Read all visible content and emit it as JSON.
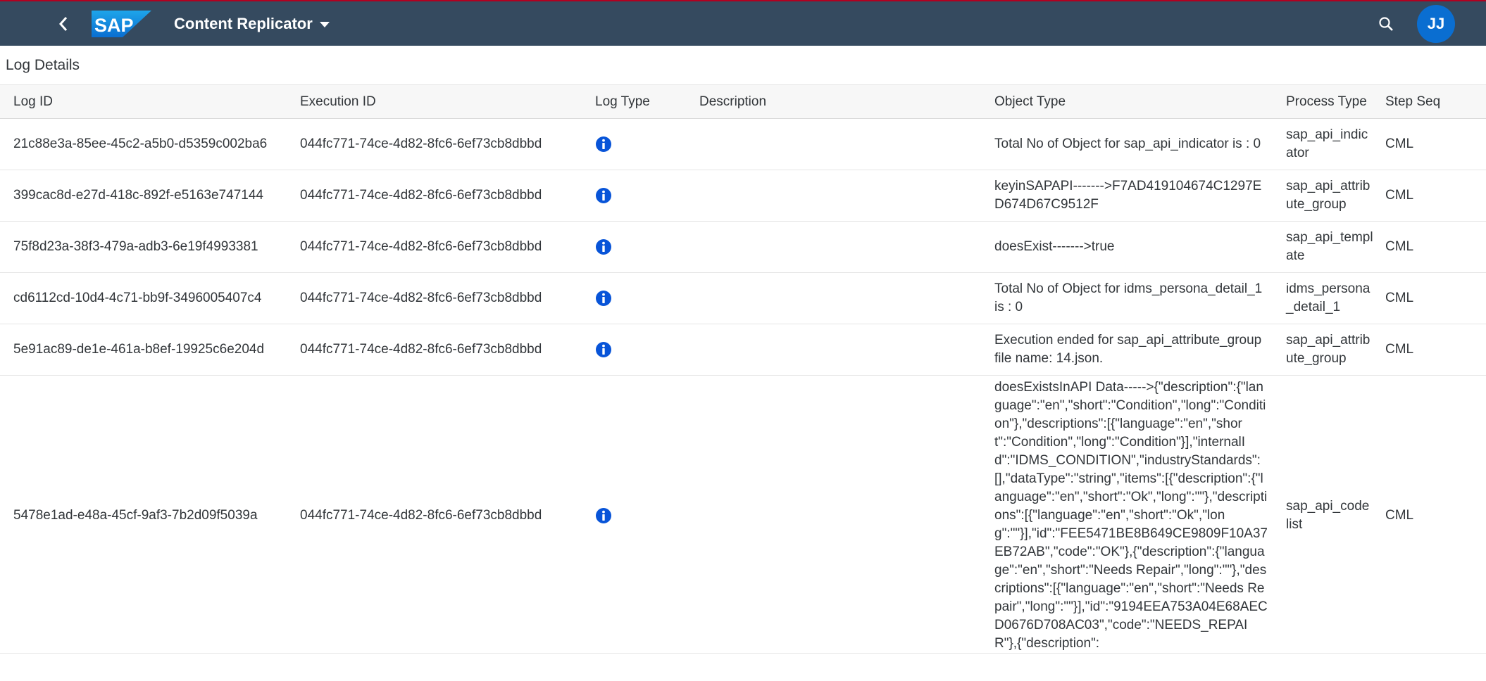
{
  "shell": {
    "app_title": "Content Replicator",
    "logo_text": "SAP",
    "user_initials": "JJ",
    "icons": {
      "back": "chevron-left-icon",
      "search": "search-icon",
      "menu": "caret-down-icon"
    },
    "colors": {
      "shell_bg": "#354a5f",
      "accent": "#0a6ed1",
      "info_icon": "#0854d8"
    }
  },
  "page": {
    "title": "Log Details"
  },
  "table": {
    "headers": {
      "log_id": "Log ID",
      "execution_id": "Execution ID",
      "log_type": "Log Type",
      "description": "Description",
      "object_type": "Object Type",
      "process_type": "Process Type",
      "step_seq": "Step Seq"
    },
    "rows": [
      {
        "log_id": "21c88e3a-85ee-45c2-a5b0-d5359c002ba6",
        "execution_id": "044fc771-74ce-4d82-8fc6-6ef73cb8dbbd",
        "log_type": "info-icon",
        "description": "",
        "object_type": "Total No of Object for sap_api_indicator is : 0",
        "process_type": "sap_api_indicator",
        "step_seq": "CML"
      },
      {
        "log_id": "399cac8d-e27d-418c-892f-e5163e747144",
        "execution_id": "044fc771-74ce-4d82-8fc6-6ef73cb8dbbd",
        "log_type": "info-icon",
        "description": "",
        "object_type": "keyinSAPAPI------->F7AD419104674C1297ED674D67C9512F",
        "process_type": "sap_api_attribute_group",
        "step_seq": "CML"
      },
      {
        "log_id": "75f8d23a-38f3-479a-adb3-6e19f4993381",
        "execution_id": "044fc771-74ce-4d82-8fc6-6ef73cb8dbbd",
        "log_type": "info-icon",
        "description": "",
        "object_type": "doesExist------->true",
        "process_type": "sap_api_template",
        "step_seq": "CML"
      },
      {
        "log_id": "cd6112cd-10d4-4c71-bb9f-3496005407c4",
        "execution_id": "044fc771-74ce-4d82-8fc6-6ef73cb8dbbd",
        "log_type": "info-icon",
        "description": "",
        "object_type": "Total No of Object for idms_persona_detail_1 is : 0",
        "process_type": "idms_persona_detail_1",
        "step_seq": "CML"
      },
      {
        "log_id": "5e91ac89-de1e-461a-b8ef-19925c6e204d",
        "execution_id": "044fc771-74ce-4d82-8fc6-6ef73cb8dbbd",
        "log_type": "info-icon",
        "description": "",
        "object_type": "Execution ended for sap_api_attribute_group file name: 14.json.",
        "process_type": "sap_api_attribute_group",
        "step_seq": "CML"
      },
      {
        "log_id": "5478e1ad-e48a-45cf-9af3-7b2d09f5039a",
        "execution_id": "044fc771-74ce-4d82-8fc6-6ef73cb8dbbd",
        "log_type": "info-icon",
        "description": "",
        "object_type": "doesExistsInAPI Data----->{\"description\":{\"language\":\"en\",\"short\":\"Condition\",\"long\":\"Condition\"},\"descriptions\":[{\"language\":\"en\",\"short\":\"Condition\",\"long\":\"Condition\"}],\"internalId\":\"IDMS_CONDITION\",\"industryStandards\":[],\"dataType\":\"string\",\"items\":[{\"description\":{\"language\":\"en\",\"short\":\"Ok\",\"long\":\"\"},\"descriptions\":[{\"language\":\"en\",\"short\":\"Ok\",\"long\":\"\"}],\"id\":\"FEE5471BE8B649CE9809F10A37EB72AB\",\"code\":\"OK\"},{\"description\":{\"language\":\"en\",\"short\":\"Needs Repair\",\"long\":\"\"},\"descriptions\":[{\"language\":\"en\",\"short\":\"Needs Repair\",\"long\":\"\"}],\"id\":\"9194EEA753A04E68AECD0676D708AC03\",\"code\":\"NEEDS_REPAIR\"},{\"description\":",
        "process_type": "sap_api_code list",
        "step_seq": "CML"
      }
    ]
  }
}
